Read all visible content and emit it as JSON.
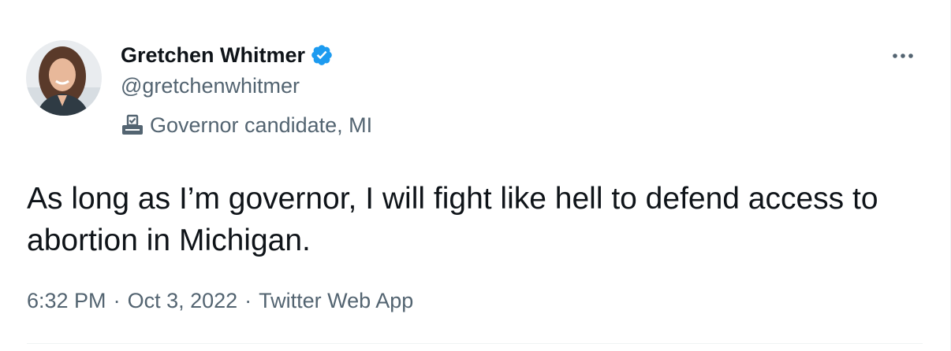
{
  "author": {
    "name": "Gretchen Whitmer",
    "handle": "@gretchenwhitmer",
    "verified": true,
    "label": "Governor candidate, MI",
    "label_icon": "ballot-box-icon",
    "avatar_icon": "avatar-photo"
  },
  "tweet": {
    "text": "As long as I’m governor, I will fight like hell to defend access to abortion in Michigan."
  },
  "meta": {
    "time": "6:32 PM",
    "separator": "·",
    "date": "Oct 3, 2022",
    "source": "Twitter Web App"
  },
  "actions": {
    "more_icon": "more-dots-icon"
  },
  "colors": {
    "verified": "#1d9bf0",
    "secondary_text": "#536471",
    "primary_text": "#0f1419",
    "divider": "#eff3f4"
  }
}
